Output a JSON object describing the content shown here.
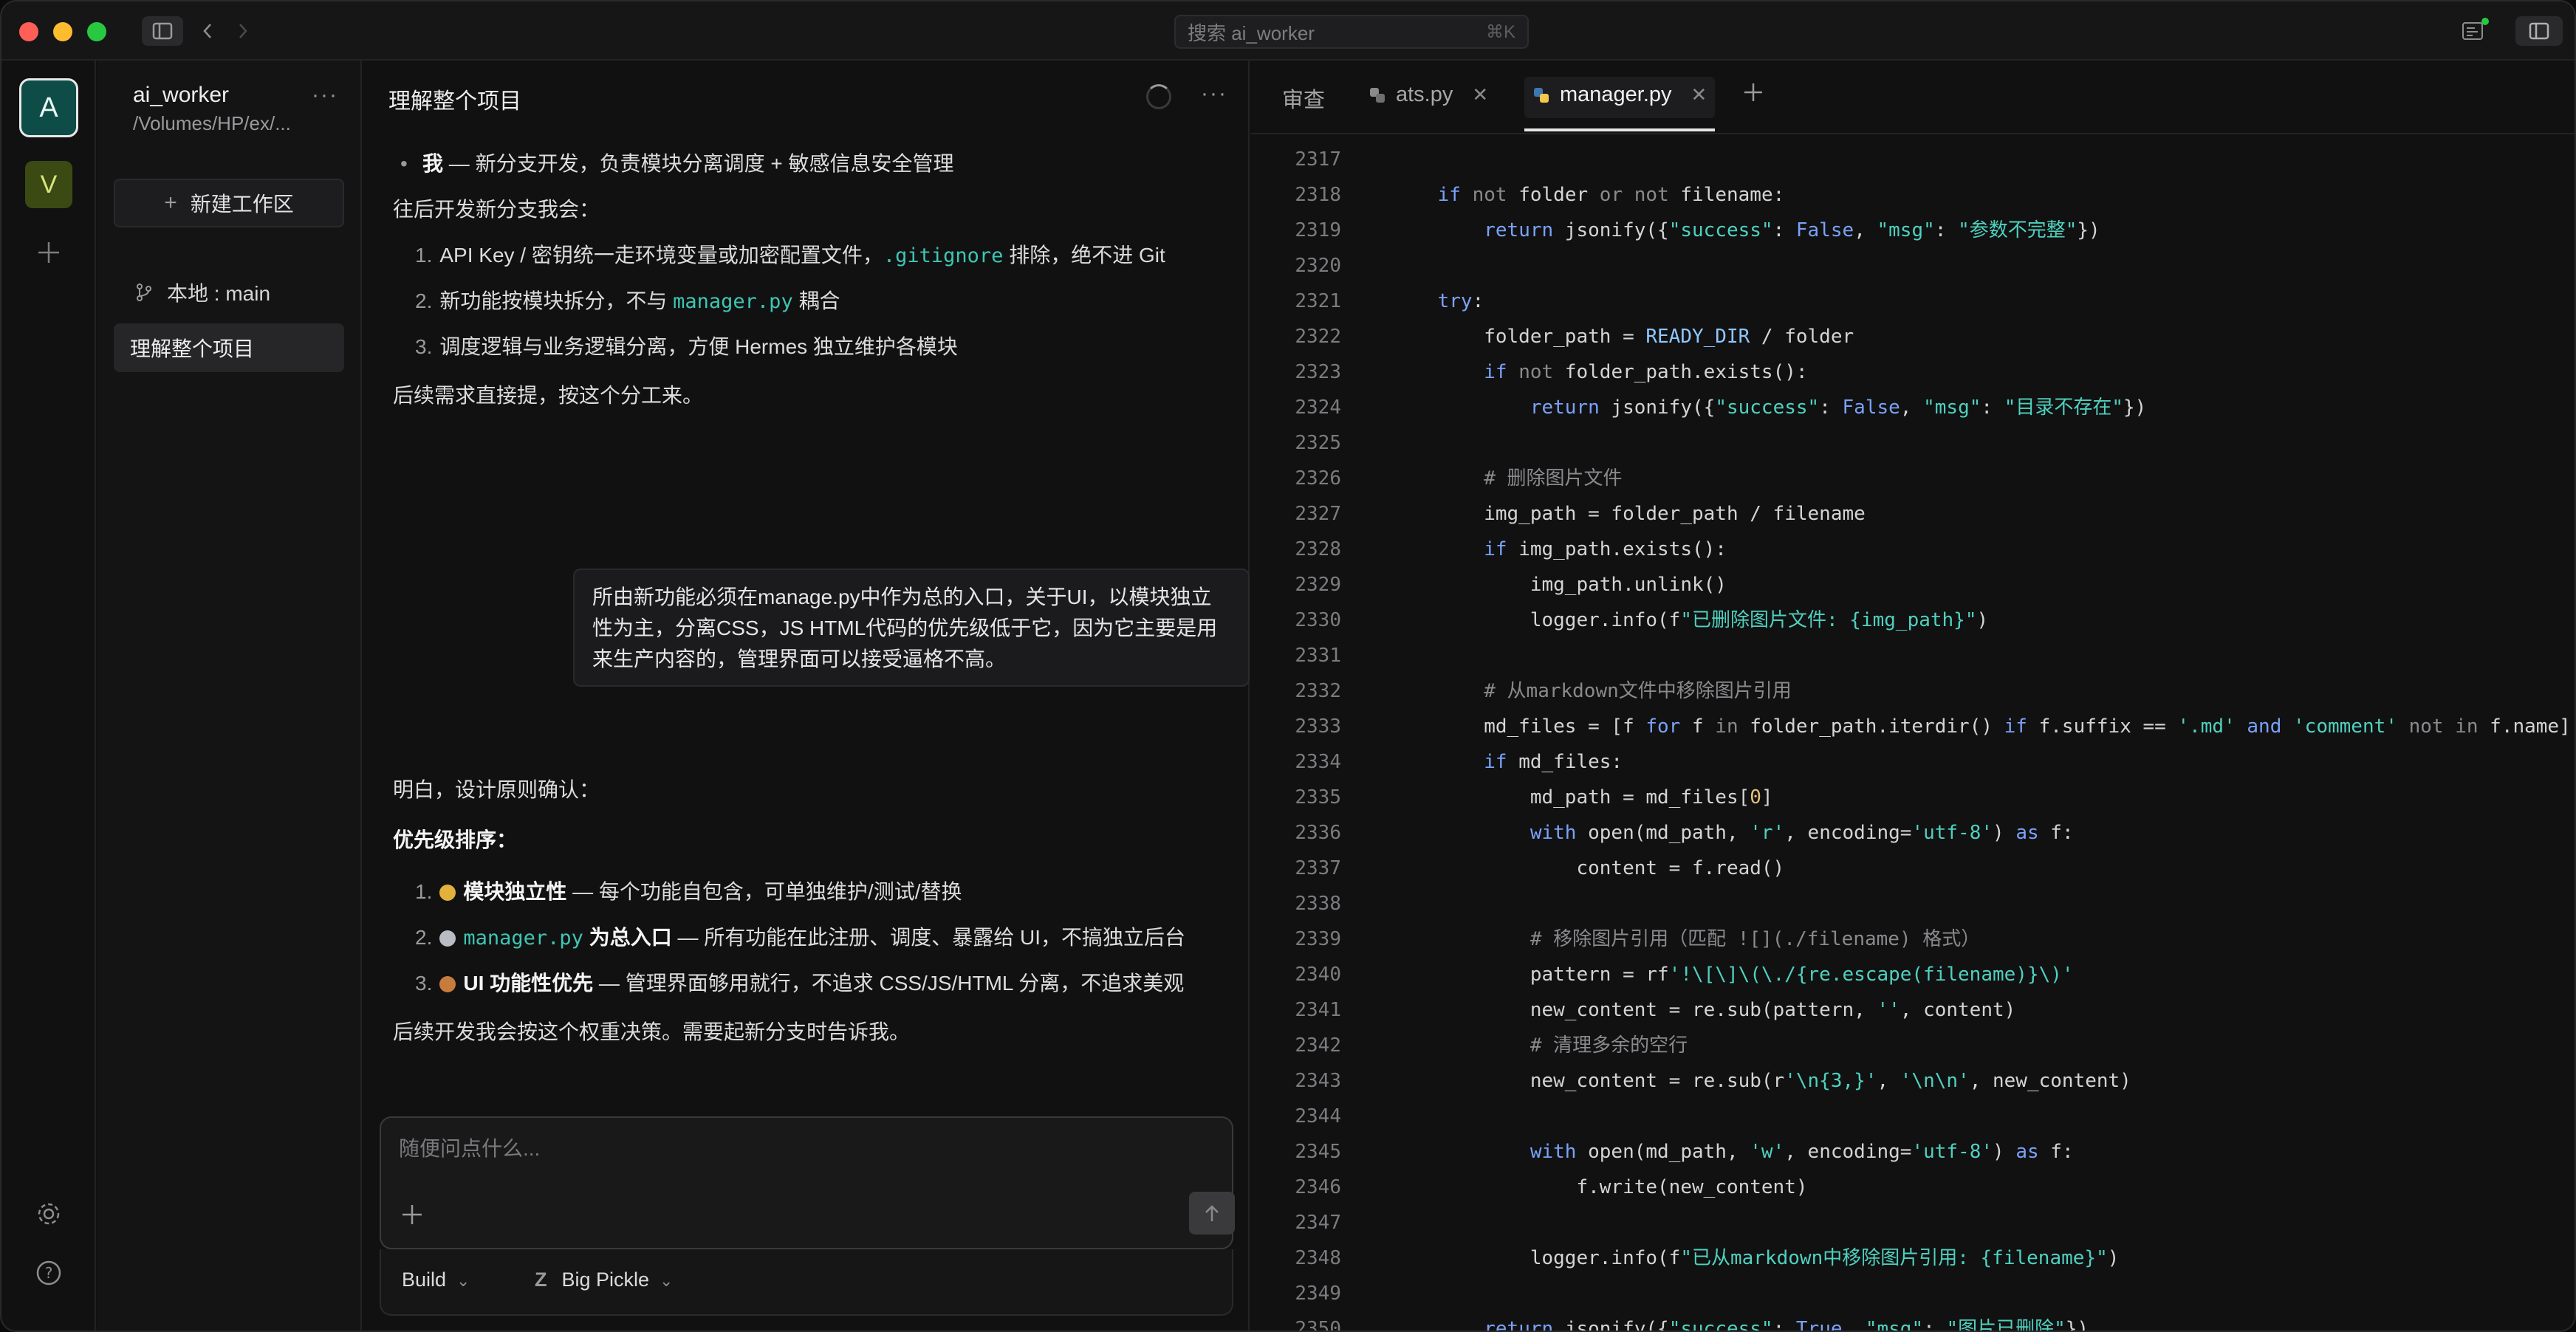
{
  "titlebar": {
    "search_placeholder": "搜索 ai_worker",
    "search_shortcut": "⌘K"
  },
  "rail": {
    "workspaces": [
      {
        "letter": "A",
        "color": "#0e4c47"
      },
      {
        "letter": "V",
        "color": "#3b4a12"
      }
    ]
  },
  "project": {
    "title": "ai_worker",
    "path": "/Volumes/HP/ex/...",
    "new_workspace": "新建工作区",
    "branch": "本地 : main",
    "session": "理解整个项目"
  },
  "chat": {
    "title": "理解整个项目",
    "bullet": {
      "bold": "我",
      "text": " — 新分支开发，负责模块分离调度 + 敏感信息安全管理"
    },
    "future_intro": "往后开发新分支我会：",
    "future_items": [
      {
        "num": "1.",
        "pre": "API Key / 密钥统一走环境变量或加密配置文件，",
        "code": ".gitignore",
        "post": " 排除，绝不进 Git"
      },
      {
        "num": "2.",
        "pre": "新功能按模块拆分，不与 ",
        "code": "manager.py",
        "post": " 耦合"
      },
      {
        "num": "3.",
        "pre": "调度逻辑与业务逻辑分离，方便 Hermes 独立维护各模块",
        "code": "",
        "post": ""
      }
    ],
    "closing1": "后续需求直接提，按这个分工来。",
    "user_message": "所由新功能必须在manage.py中作为总的入口，关于UI，以模块独立性为主，分离CSS，JS HTML代码的优先级低于它，因为它主要是用来生产内容的，管理界面可以接受逼格不高。",
    "reply_intro": "明白，设计原则确认：",
    "priority_title": "优先级排序：",
    "priority_items": [
      {
        "num": "1.",
        "medal": "gold",
        "bold": "模块独立性",
        "code": "",
        "text": " — 每个功能自包含，可单独维护/测试/替换"
      },
      {
        "num": "2.",
        "medal": "silver",
        "bold": " 为总入口",
        "code": "manager.py",
        "text": " — 所有功能在此注册、调度、暴露给 UI，不搞独立后台"
      },
      {
        "num": "3.",
        "medal": "bronze",
        "bold": "UI 功能性优先",
        "code": "",
        "text": " — 管理界面够用就行，不追求 CSS/JS/HTML 分离，不追求美观"
      }
    ],
    "closing2": "后续开发我会按这个权重决策。需要起新分支时告诉我。",
    "composer_placeholder": "随便问点什么...",
    "mode": "Build",
    "model": "Big Pickle"
  },
  "editor": {
    "tabs": [
      {
        "label": "审查"
      },
      {
        "label": "ats.py"
      },
      {
        "label": "manager.py"
      }
    ],
    "code_lines": [
      {
        "n": "2317",
        "t": ""
      },
      {
        "n": "2318",
        "t": "    if not folder or not filename:"
      },
      {
        "n": "2319",
        "t": "        return jsonify({\"success\": False, \"msg\": \"参数不完整\"})"
      },
      {
        "n": "2320",
        "t": ""
      },
      {
        "n": "2321",
        "t": "    try:"
      },
      {
        "n": "2322",
        "t": "        folder_path = READY_DIR / folder"
      },
      {
        "n": "2323",
        "t": "        if not folder_path.exists():"
      },
      {
        "n": "2324",
        "t": "            return jsonify({\"success\": False, \"msg\": \"目录不存在\"})"
      },
      {
        "n": "2325",
        "t": ""
      },
      {
        "n": "2326",
        "t": "        # 删除图片文件"
      },
      {
        "n": "2327",
        "t": "        img_path = folder_path / filename"
      },
      {
        "n": "2328",
        "t": "        if img_path.exists():"
      },
      {
        "n": "2329",
        "t": "            img_path.unlink()"
      },
      {
        "n": "2330",
        "t": "            logger.info(f\"已删除图片文件: {img_path}\")"
      },
      {
        "n": "2331",
        "t": ""
      },
      {
        "n": "2332",
        "t": "        # 从markdown文件中移除图片引用"
      },
      {
        "n": "2333",
        "t": "        md_files = [f for f in folder_path.iterdir() if f.suffix == '.md' and 'comment' not in f.name]"
      },
      {
        "n": "2334",
        "t": "        if md_files:"
      },
      {
        "n": "2335",
        "t": "            md_path = md_files[0]"
      },
      {
        "n": "2336",
        "t": "            with open(md_path, 'r', encoding='utf-8') as f:"
      },
      {
        "n": "2337",
        "t": "                content = f.read()"
      },
      {
        "n": "2338",
        "t": ""
      },
      {
        "n": "2339",
        "t": "            # 移除图片引用（匹配 ![](./filename) 格式）"
      },
      {
        "n": "2340",
        "t": "            pattern = rf'!\\[\\]\\(\\./{re.escape(filename)}\\)'"
      },
      {
        "n": "2341",
        "t": "            new_content = re.sub(pattern, '', content)"
      },
      {
        "n": "2342",
        "t": "            # 清理多余的空行"
      },
      {
        "n": "2343",
        "t": "            new_content = re.sub(r'\\n{3,}', '\\n\\n', new_content)"
      },
      {
        "n": "2344",
        "t": ""
      },
      {
        "n": "2345",
        "t": "            with open(md_path, 'w', encoding='utf-8') as f:"
      },
      {
        "n": "2346",
        "t": "                f.write(new_content)"
      },
      {
        "n": "2347",
        "t": ""
      },
      {
        "n": "2348",
        "t": "            logger.info(f\"已从markdown中移除图片引用: {filename}\")"
      },
      {
        "n": "2349",
        "t": ""
      },
      {
        "n": "2350",
        "t": "        return jsonify({\"success\": True, \"msg\": \"图片已删除\"})"
      }
    ]
  }
}
